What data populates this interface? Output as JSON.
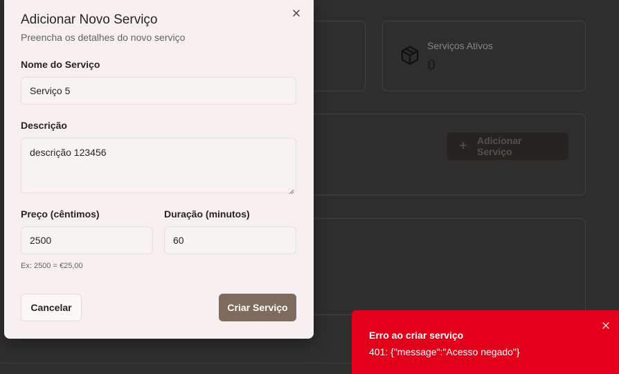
{
  "background": {
    "stat_active_label": "Serviços Ativos",
    "stat_active_value": "0",
    "add_service_button": "Adicionar Serviço"
  },
  "modal": {
    "title": "Adicionar Novo Serviço",
    "subtitle": "Preencha os detalhes do novo serviço",
    "name_label": "Nome do Serviço",
    "name_value": "Serviço 5",
    "description_label": "Descrição",
    "description_value": "descrição 123456",
    "price_label": "Preço (cêntimos)",
    "price_value": "2500",
    "price_hint": "Ex: 2500 = €25,00",
    "duration_label": "Duração (minutos)",
    "duration_value": "60",
    "cancel_label": "Cancelar",
    "create_label": "Criar Serviço"
  },
  "toast": {
    "title": "Erro ao criar serviço",
    "message": "401: {\"message\":\"Acesso negado\"}"
  },
  "colors": {
    "primary_button": "#7e6b5e",
    "toast_error": "#e3001b",
    "modal_bg": "#f6f1f0"
  }
}
